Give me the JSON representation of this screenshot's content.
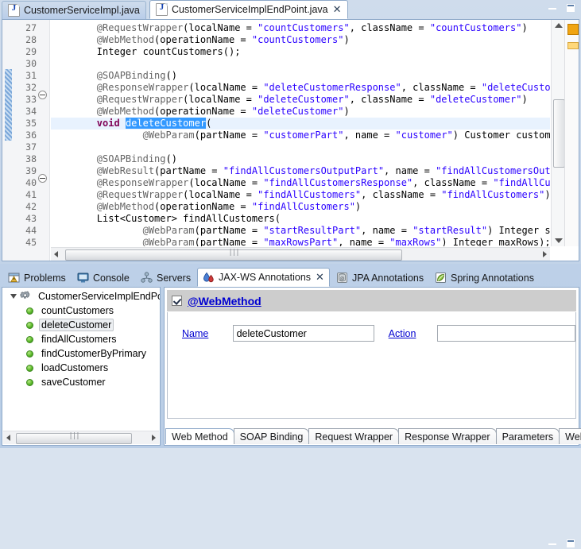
{
  "window": {
    "minimize_label": "Minimize",
    "maximize_label": "Maximize"
  },
  "editor": {
    "tabs": [
      {
        "label": "CustomerServiceImpl.java",
        "icon": "java-file-icon",
        "active": false,
        "closable": false
      },
      {
        "label": "CustomerServiceImplEndPoint.java",
        "icon": "java-file-icon",
        "active": true,
        "closable": true,
        "close_glyph": "✕"
      }
    ],
    "first_line_number": 27,
    "lines": [
      {
        "n": 27,
        "fold": false,
        "changed": false,
        "tokens": [
          {
            "t": "        ",
            "c": "plain"
          },
          {
            "t": "@RequestWrapper",
            "c": "ann"
          },
          {
            "t": "(localName = ",
            "c": "plain"
          },
          {
            "t": "\"countCustomers\"",
            "c": "str"
          },
          {
            "t": ", className = ",
            "c": "plain"
          },
          {
            "t": "\"countCustomers\"",
            "c": "str"
          },
          {
            "t": ")",
            "c": "plain"
          }
        ]
      },
      {
        "n": 28,
        "fold": false,
        "changed": false,
        "tokens": [
          {
            "t": "        ",
            "c": "plain"
          },
          {
            "t": "@WebMethod",
            "c": "ann"
          },
          {
            "t": "(operationName = ",
            "c": "plain"
          },
          {
            "t": "\"countCustomers\"",
            "c": "str"
          },
          {
            "t": ")",
            "c": "plain"
          }
        ]
      },
      {
        "n": 29,
        "fold": false,
        "changed": false,
        "tokens": [
          {
            "t": "        Integer countCustomers();",
            "c": "plain"
          }
        ]
      },
      {
        "n": 30,
        "fold": false,
        "changed": false,
        "tokens": [
          {
            "t": "",
            "c": "plain"
          }
        ]
      },
      {
        "n": 31,
        "fold": true,
        "changed": true,
        "tokens": [
          {
            "t": "        ",
            "c": "plain"
          },
          {
            "t": "@SOAPBinding",
            "c": "ann"
          },
          {
            "t": "()",
            "c": "plain"
          }
        ]
      },
      {
        "n": 32,
        "fold": false,
        "changed": true,
        "tokens": [
          {
            "t": "        ",
            "c": "plain"
          },
          {
            "t": "@ResponseWrapper",
            "c": "ann"
          },
          {
            "t": "(localName = ",
            "c": "plain"
          },
          {
            "t": "\"deleteCustomerResponse\"",
            "c": "str"
          },
          {
            "t": ", className = ",
            "c": "plain"
          },
          {
            "t": "\"deleteCustomerResponse\"",
            "c": "str"
          },
          {
            "t": ")",
            "c": "plain"
          }
        ]
      },
      {
        "n": 33,
        "fold": false,
        "changed": true,
        "tokens": [
          {
            "t": "        ",
            "c": "plain"
          },
          {
            "t": "@RequestWrapper",
            "c": "ann"
          },
          {
            "t": "(localName = ",
            "c": "plain"
          },
          {
            "t": "\"deleteCustomer\"",
            "c": "str"
          },
          {
            "t": ", className = ",
            "c": "plain"
          },
          {
            "t": "\"deleteCustomer\"",
            "c": "str"
          },
          {
            "t": ")",
            "c": "plain"
          }
        ]
      },
      {
        "n": 34,
        "fold": false,
        "changed": true,
        "tokens": [
          {
            "t": "        ",
            "c": "plain"
          },
          {
            "t": "@WebMethod",
            "c": "ann"
          },
          {
            "t": "(operationName = ",
            "c": "plain"
          },
          {
            "t": "\"deleteCustomer\"",
            "c": "str"
          },
          {
            "t": ")",
            "c": "plain"
          }
        ]
      },
      {
        "n": 35,
        "fold": false,
        "changed": true,
        "highlight": true,
        "tokens": [
          {
            "t": "        ",
            "c": "plain"
          },
          {
            "t": "void",
            "c": "kw"
          },
          {
            "t": " ",
            "c": "plain"
          },
          {
            "t": "deleteCustomer",
            "c": "sel"
          },
          {
            "t": "(",
            "c": "plain"
          }
        ]
      },
      {
        "n": 36,
        "fold": false,
        "changed": true,
        "tokens": [
          {
            "t": "                ",
            "c": "plain"
          },
          {
            "t": "@WebParam",
            "c": "ann"
          },
          {
            "t": "(partName = ",
            "c": "plain"
          },
          {
            "t": "\"customerPart\"",
            "c": "str"
          },
          {
            "t": ", name = ",
            "c": "plain"
          },
          {
            "t": "\"customer\"",
            "c": "str"
          },
          {
            "t": ") Customer customer);",
            "c": "plain"
          }
        ]
      },
      {
        "n": 37,
        "fold": false,
        "changed": false,
        "tokens": [
          {
            "t": "",
            "c": "plain"
          }
        ]
      },
      {
        "n": 38,
        "fold": true,
        "changed": false,
        "tokens": [
          {
            "t": "        ",
            "c": "plain"
          },
          {
            "t": "@SOAPBinding",
            "c": "ann"
          },
          {
            "t": "()",
            "c": "plain"
          }
        ]
      },
      {
        "n": 39,
        "fold": false,
        "changed": false,
        "tokens": [
          {
            "t": "        ",
            "c": "plain"
          },
          {
            "t": "@WebResult",
            "c": "ann"
          },
          {
            "t": "(partName = ",
            "c": "plain"
          },
          {
            "t": "\"findAllCustomersOutputPart\"",
            "c": "str"
          },
          {
            "t": ", name = ",
            "c": "plain"
          },
          {
            "t": "\"findAllCustomersOutput\"",
            "c": "str"
          },
          {
            "t": ")",
            "c": "plain"
          }
        ]
      },
      {
        "n": 40,
        "fold": false,
        "changed": false,
        "tokens": [
          {
            "t": "        ",
            "c": "plain"
          },
          {
            "t": "@ResponseWrapper",
            "c": "ann"
          },
          {
            "t": "(localName = ",
            "c": "plain"
          },
          {
            "t": "\"findAllCustomersResponse\"",
            "c": "str"
          },
          {
            "t": ", className = ",
            "c": "plain"
          },
          {
            "t": "\"findAllCustomersResponse\"",
            "c": "str"
          },
          {
            "t": ")",
            "c": "plain"
          }
        ]
      },
      {
        "n": 41,
        "fold": false,
        "changed": false,
        "tokens": [
          {
            "t": "        ",
            "c": "plain"
          },
          {
            "t": "@RequestWrapper",
            "c": "ann"
          },
          {
            "t": "(localName = ",
            "c": "plain"
          },
          {
            "t": "\"findAllCustomers\"",
            "c": "str"
          },
          {
            "t": ", className = ",
            "c": "plain"
          },
          {
            "t": "\"findAllCustomers\"",
            "c": "str"
          },
          {
            "t": ")",
            "c": "plain"
          }
        ]
      },
      {
        "n": 42,
        "fold": false,
        "changed": false,
        "tokens": [
          {
            "t": "        ",
            "c": "plain"
          },
          {
            "t": "@WebMethod",
            "c": "ann"
          },
          {
            "t": "(operationName = ",
            "c": "plain"
          },
          {
            "t": "\"findAllCustomers\"",
            "c": "str"
          },
          {
            "t": ")",
            "c": "plain"
          }
        ]
      },
      {
        "n": 43,
        "fold": false,
        "changed": false,
        "tokens": [
          {
            "t": "        List<Customer> findAllCustomers(",
            "c": "plain"
          }
        ]
      },
      {
        "n": 44,
        "fold": false,
        "changed": false,
        "tokens": [
          {
            "t": "                ",
            "c": "plain"
          },
          {
            "t": "@WebParam",
            "c": "ann"
          },
          {
            "t": "(partName = ",
            "c": "plain"
          },
          {
            "t": "\"startResultPart\"",
            "c": "str"
          },
          {
            "t": ", name = ",
            "c": "plain"
          },
          {
            "t": "\"startResult\"",
            "c": "str"
          },
          {
            "t": ") Integer startResult",
            "c": "plain"
          }
        ]
      },
      {
        "n": 45,
        "fold": false,
        "changed": false,
        "tokens": [
          {
            "t": "                ",
            "c": "plain"
          },
          {
            "t": "@WebParam",
            "c": "ann"
          },
          {
            "t": "(partName = ",
            "c": "plain"
          },
          {
            "t": "\"maxRowsPart\"",
            "c": "str"
          },
          {
            "t": ", name = ",
            "c": "plain"
          },
          {
            "t": "\"maxRows\"",
            "c": "str"
          },
          {
            "t": ") Integer maxRows);",
            "c": "plain"
          }
        ]
      }
    ]
  },
  "view_part": {
    "tabs": [
      {
        "label": "Problems",
        "icon": "problems-icon",
        "active": false,
        "closable": false
      },
      {
        "label": "Console",
        "icon": "console-icon",
        "active": false,
        "closable": false
      },
      {
        "label": "Servers",
        "icon": "servers-icon",
        "active": false,
        "closable": false
      },
      {
        "label": "JAX-WS Annotations",
        "icon": "jaxws-icon",
        "active": true,
        "closable": true,
        "close_glyph": "✕"
      },
      {
        "label": "JPA Annotations",
        "icon": "jpa-icon",
        "active": false,
        "closable": false
      },
      {
        "label": "Spring Annotations",
        "icon": "spring-icon",
        "active": false,
        "closable": false
      }
    ],
    "tree": {
      "root": {
        "label": "CustomerServiceImplEndPo",
        "icon": "gear-icon",
        "expanded": true
      },
      "items": [
        {
          "label": "countCustomers",
          "selected": false
        },
        {
          "label": "deleteCustomer",
          "selected": true
        },
        {
          "label": "findAllCustomers",
          "selected": false
        },
        {
          "label": "findCustomerByPrimary",
          "selected": false
        },
        {
          "label": "loadCustomers",
          "selected": false
        },
        {
          "label": "saveCustomer",
          "selected": false
        }
      ]
    },
    "form": {
      "section_title": "@WebMethod",
      "section_checked": true,
      "fields": [
        {
          "label": "Name",
          "value": "deleteCustomer",
          "placeholder": ""
        },
        {
          "label": "Action",
          "value": "",
          "placeholder": ""
        }
      ],
      "tabs": [
        {
          "label": "Web Method",
          "active": true
        },
        {
          "label": "SOAP Binding",
          "active": false
        },
        {
          "label": "Request Wrapper",
          "active": false
        },
        {
          "label": "Response Wrapper",
          "active": false
        },
        {
          "label": "Parameters",
          "active": false
        },
        {
          "label": "Web Result",
          "active": false
        }
      ]
    }
  }
}
